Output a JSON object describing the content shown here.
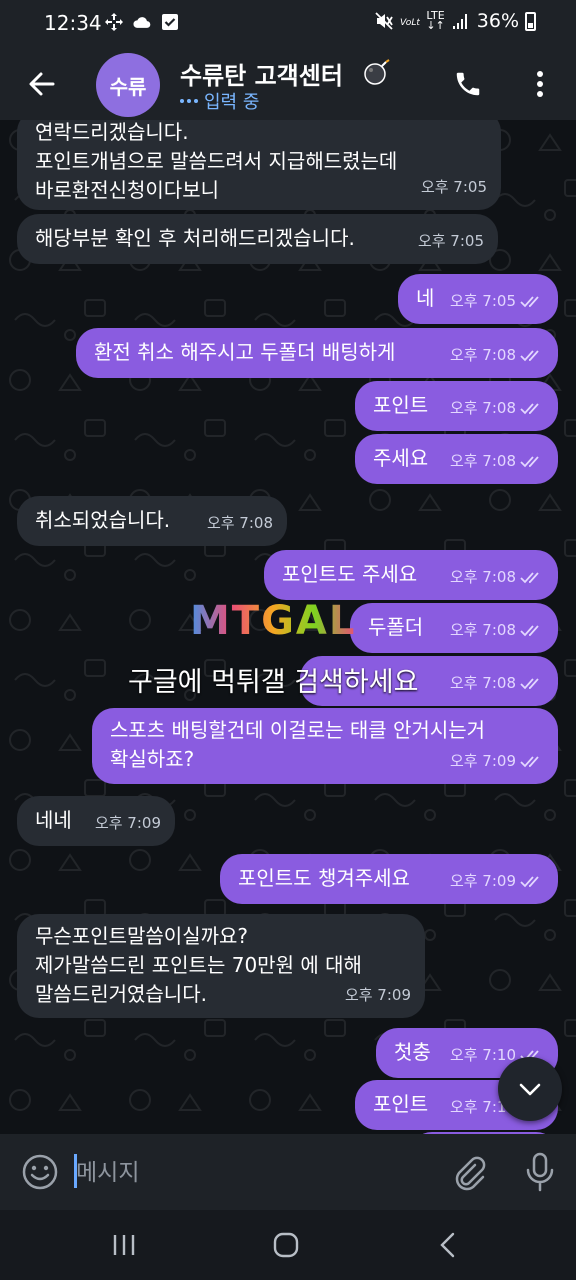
{
  "status": {
    "time": "12:34",
    "battery": "36%",
    "network": "LTE"
  },
  "header": {
    "avatar_text": "수류",
    "title": "수류탄 고객센터",
    "typing": "입력 중"
  },
  "messages": [
    {
      "dir": "in",
      "text": "연락드리겠습니다.\n포인트개념으로 말씀드려서 지급해드렸는데\n바로환전신청이다보니",
      "time": "오후 7:05"
    },
    {
      "dir": "in",
      "text": "해당부분 확인 후 처리해드리겠습니다.",
      "time": "오후 7:05"
    },
    {
      "dir": "out",
      "text": "네",
      "time": "오후 7:05"
    },
    {
      "dir": "out",
      "text": "환전 취소 해주시고 두폴더 배팅하게",
      "time": "오후 7:08"
    },
    {
      "dir": "out",
      "text": "포인트",
      "time": "오후 7:08"
    },
    {
      "dir": "out",
      "text": "주세요",
      "time": "오후 7:08"
    },
    {
      "dir": "in",
      "text": "취소되었습니다.",
      "time": "오후 7:08"
    },
    {
      "dir": "out",
      "text": "포인트도 주세요",
      "time": "오후 7:08"
    },
    {
      "dir": "out",
      "text": "두폴더",
      "time": "오후 7:08"
    },
    {
      "dir": "out",
      "text": "",
      "time": "오후 7:08"
    },
    {
      "dir": "out",
      "text": "스포츠 배팅할건데 이걸로는 태클 안거시는거\n확실하죠?",
      "time": "오후 7:09"
    },
    {
      "dir": "in",
      "text": "네네",
      "time": "오후 7:09"
    },
    {
      "dir": "out",
      "text": "포인트도 챙겨주세요",
      "time": "오후 7:09"
    },
    {
      "dir": "in",
      "text": "무슨포인트말씀이실까요?\n제가말씀드린 포인트는 70만원 에 대해\n말씀드린거였습니다.",
      "time": "오후 7:09"
    },
    {
      "dir": "out",
      "text": "첫충",
      "time": "오후 7:10"
    },
    {
      "dir": "out",
      "text": "포인트",
      "time": "오후 7:10"
    }
  ],
  "watermark": {
    "logo": "MTGAL",
    "subtitle": "구글에 먹튀갤 검색하세요"
  },
  "composer": {
    "placeholder": "메시지"
  },
  "colors": {
    "outgoing_bubble": "#8a5ce0",
    "incoming_bubble": "#272c33",
    "accent": "#7ab6ff",
    "avatar": "#8e6fe0"
  }
}
